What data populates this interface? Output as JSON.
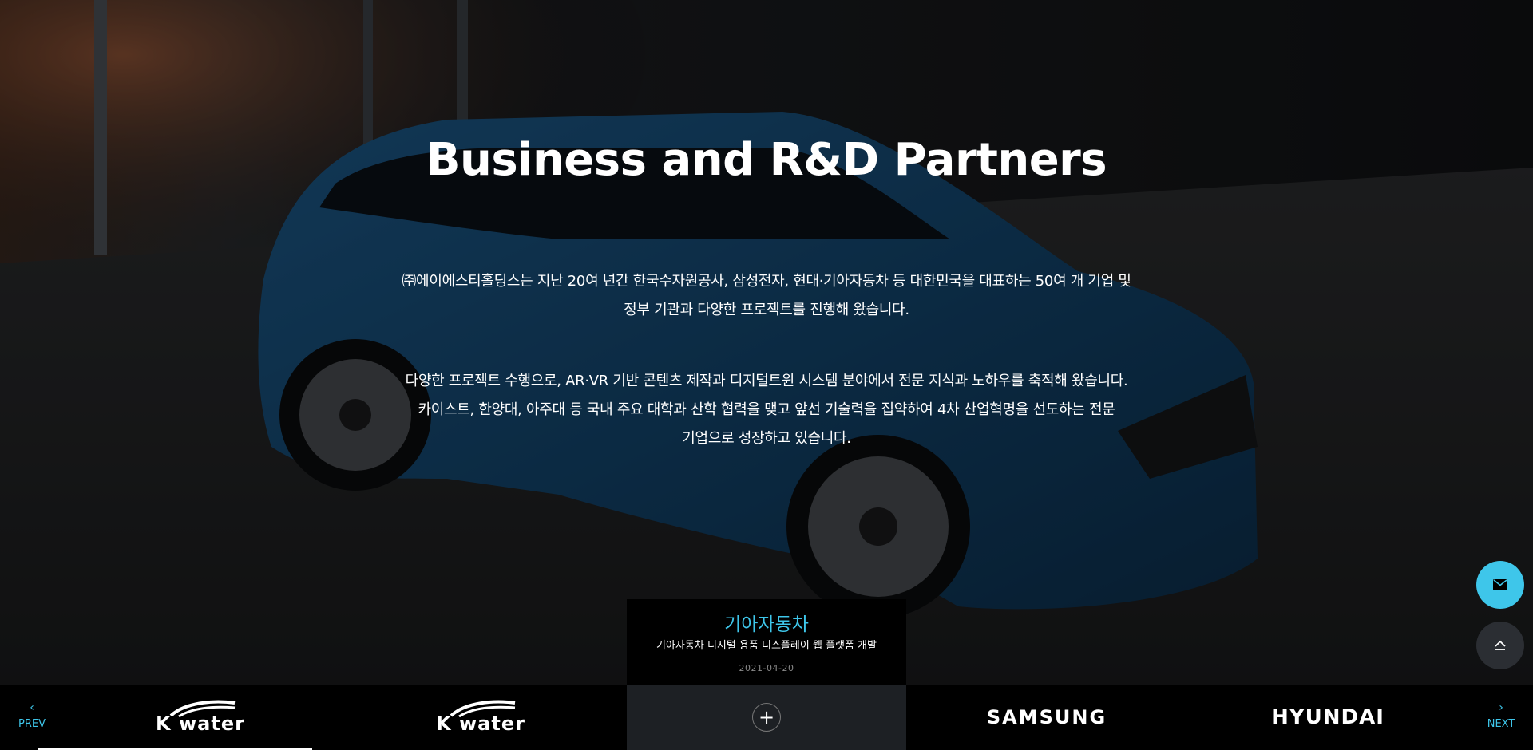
{
  "hero": {
    "title": "Business and R&D Partners",
    "para1_line1": "㈜에이에스티홀딩스는 지난 20여 년간 한국수자원공사, 삼성전자, 현대·기아자동차 등 대한민국을 대표하는 50여 개 기업 및",
    "para1_line2": "정부 기관과 다양한 프로젝트를 진행해 왔습니다.",
    "para2_line1": "다양한 프로젝트 수행으로, AR·VR 기반 콘텐츠 제작과 디지털트윈 시스템 분야에서 전문 지식과 노하우를 축적해 왔습니다.",
    "para2_line2": "카이스트, 한양대, 아주대 등 국내 주요 대학과 산학 협력을 맺고 앞선 기술력을 집약하여 4차 산업혁명을 선도하는 전문",
    "para2_line3": "기업으로 성장하고 있습니다."
  },
  "project_card": {
    "client": "기아자동차",
    "description": "기아자동차 디지털 용품 디스플레이 웹 플랫폼 개발",
    "date": "2021-04-20"
  },
  "carousel": {
    "prev_label": "PREV",
    "next_label": "NEXT",
    "prev_icon": "chevron-left-icon",
    "next_icon": "chevron-right-icon",
    "logos": [
      "K water",
      "K water",
      "+",
      "SAMSUNG",
      "HYUNDAI"
    ]
  },
  "colors": {
    "accent": "#3ec6ea",
    "strip_bg": "#000000",
    "active_cell_bg": "#1d2024"
  },
  "fabs": {
    "mail_icon": "mail-icon",
    "top_icon": "scroll-top-icon"
  }
}
